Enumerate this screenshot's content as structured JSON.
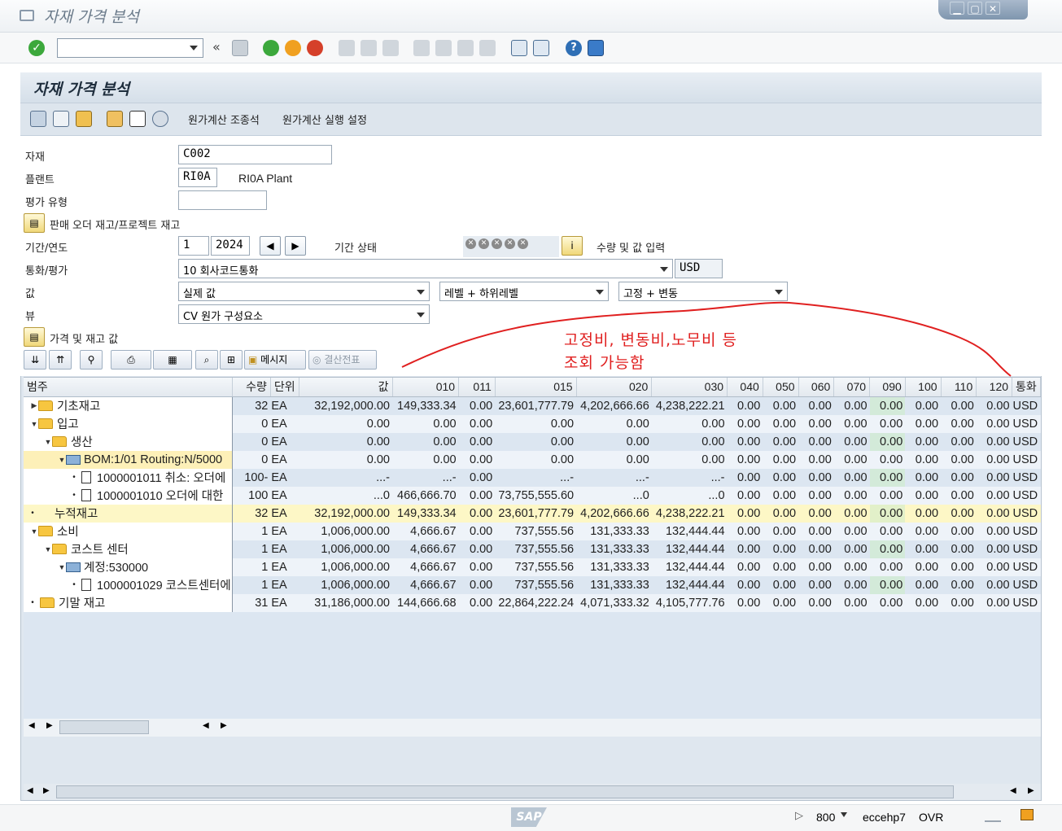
{
  "window": {
    "title": "자재 가격 분석"
  },
  "app": {
    "title": "자재 가격 분석",
    "toolbar": {
      "costing_structure": "원가계산 조종석",
      "costing_run_settings": "원가계산 실행 설정"
    }
  },
  "form": {
    "material_label": "자재",
    "material_value": "C002",
    "plant_label": "플랜트",
    "plant_value": "RI0A",
    "plant_desc": "RI0A Plant",
    "valtype_label": "평가 유형",
    "valtype_value": "",
    "sales_order_stock": "판매 오더 재고/프로젝트 재고",
    "period_label": "기간/연도",
    "period_value": "1",
    "year_value": "2024",
    "period_status_label": "기간 상태",
    "qty_value_entry": "수량 및 값 입력",
    "currency_label": "통화/평가",
    "currency_value": "10 회사코드통화",
    "currency_code": "USD",
    "value_label": "값",
    "value_value": "실제 값",
    "level_value": "레벨 + 하위레벨",
    "fixvar_value": "고정 + 변동",
    "view_label": "뷰",
    "view_value": "CV 원가 구성요소",
    "price_stock_values": "가격 및 재고 값"
  },
  "alv": {
    "message_btn": "메시지",
    "settlement_btn": "결산전표"
  },
  "annotation": {
    "line1": "고정비, 변동비,노무비 등",
    "line2": "조회 가능함"
  },
  "grid": {
    "headers": [
      "범주",
      "수량",
      "단위",
      "값",
      "010",
      "011",
      "015",
      "020",
      "030",
      "040",
      "050",
      "060",
      "070",
      "090",
      "100",
      "110",
      "120",
      "통화"
    ],
    "rows": [
      {
        "label": "기초재고",
        "qty": "32",
        "unit": "EA",
        "val": "32,192,000.00",
        "c010": "149,333.34",
        "c011": "0.00",
        "c015": "23,601,777.79",
        "c020": "4,202,666.66",
        "c030": "4,238,222.21",
        "z": "0.00",
        "cur": "USD"
      },
      {
        "label": "입고",
        "qty": "0",
        "unit": "EA",
        "val": "0.00",
        "c010": "0.00",
        "c011": "0.00",
        "c015": "0.00",
        "c020": "0.00",
        "c030": "0.00",
        "z": "0.00",
        "cur": "USD"
      },
      {
        "label": "생산",
        "qty": "0",
        "unit": "EA",
        "val": "0.00",
        "c010": "0.00",
        "c011": "0.00",
        "c015": "0.00",
        "c020": "0.00",
        "c030": "0.00",
        "z": "0.00",
        "cur": "USD"
      },
      {
        "label": "BOM:1/01 Routing:N/5000",
        "qty": "0",
        "unit": "EA",
        "val": "0.00",
        "c010": "0.00",
        "c011": "0.00",
        "c015": "0.00",
        "c020": "0.00",
        "c030": "0.00",
        "z": "0.00",
        "cur": "USD"
      },
      {
        "label": "1000001011 취소: 오더에",
        "qty": "100-",
        "unit": "EA",
        "val": "...-",
        "c010": "...-",
        "c011": "0.00",
        "c015": "...-",
        "c020": "...-",
        "c030": "...-",
        "z": "0.00",
        "cur": "USD"
      },
      {
        "label": "1000001010 오더에 대한",
        "qty": "100",
        "unit": "EA",
        "val": "...0",
        "c010": "466,666.70",
        "c011": "0.00",
        "c015": "73,755,555.60",
        "c020": "...0",
        "c030": "...0",
        "z": "0.00",
        "cur": "USD"
      },
      {
        "label": "누적재고",
        "qty": "32",
        "unit": "EA",
        "val": "32,192,000.00",
        "c010": "149,333.34",
        "c011": "0.00",
        "c015": "23,601,777.79",
        "c020": "4,202,666.66",
        "c030": "4,238,222.21",
        "z": "0.00",
        "cur": "USD"
      },
      {
        "label": "소비",
        "qty": "1",
        "unit": "EA",
        "val": "1,006,000.00",
        "c010": "4,666.67",
        "c011": "0.00",
        "c015": "737,555.56",
        "c020": "131,333.33",
        "c030": "132,444.44",
        "z": "0.00",
        "cur": "USD"
      },
      {
        "label": "코스트 센터",
        "qty": "1",
        "unit": "EA",
        "val": "1,006,000.00",
        "c010": "4,666.67",
        "c011": "0.00",
        "c015": "737,555.56",
        "c020": "131,333.33",
        "c030": "132,444.44",
        "z": "0.00",
        "cur": "USD"
      },
      {
        "label": "계정:530000",
        "qty": "1",
        "unit": "EA",
        "val": "1,006,000.00",
        "c010": "4,666.67",
        "c011": "0.00",
        "c015": "737,555.56",
        "c020": "131,333.33",
        "c030": "132,444.44",
        "z": "0.00",
        "cur": "USD"
      },
      {
        "label": "1000001029 코스트센터에",
        "qty": "1",
        "unit": "EA",
        "val": "1,006,000.00",
        "c010": "4,666.67",
        "c011": "0.00",
        "c015": "737,555.56",
        "c020": "131,333.33",
        "c030": "132,444.44",
        "z": "0.00",
        "cur": "USD"
      },
      {
        "label": "기말 재고",
        "qty": "31",
        "unit": "EA",
        "val": "31,186,000.00",
        "c010": "144,666.68",
        "c011": "0.00",
        "c015": "22,864,222.24",
        "c020": "4,071,333.32",
        "c030": "4,105,777.76",
        "z": "0.00",
        "cur": "USD"
      }
    ]
  },
  "status": {
    "client": "800",
    "system": "eccehp7",
    "mode": "OVR",
    "logo": "SAP"
  }
}
